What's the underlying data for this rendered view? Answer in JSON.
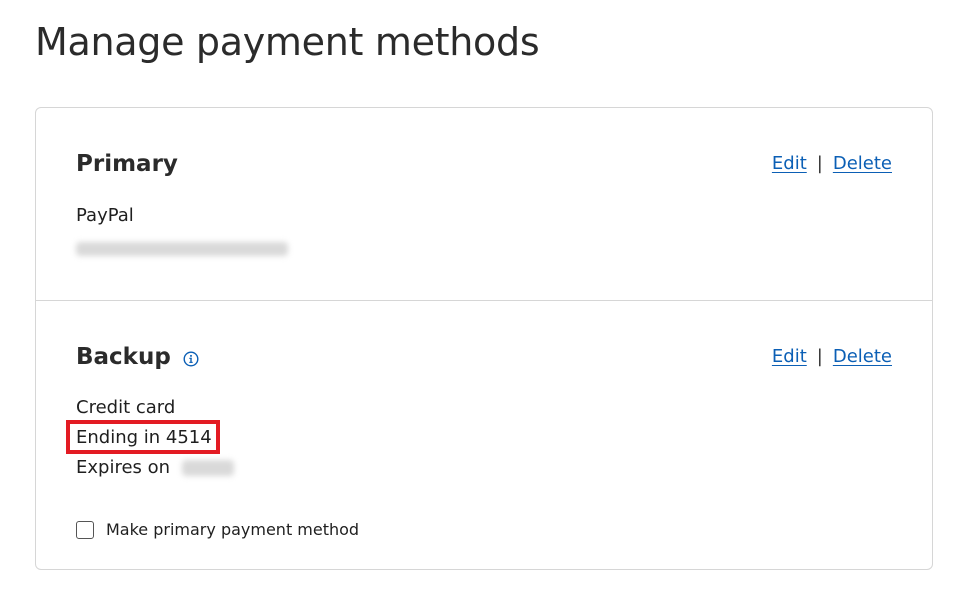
{
  "page": {
    "title": "Manage payment methods"
  },
  "primary": {
    "heading": "Primary",
    "edit_label": "Edit",
    "separator": "|",
    "delete_label": "Delete",
    "method_name": "PayPal"
  },
  "backup": {
    "heading": "Backup",
    "info_icon": "info-icon",
    "edit_label": "Edit",
    "separator": "|",
    "delete_label": "Delete",
    "method_type": "Credit card",
    "ending": "Ending in 4514",
    "expires_label": "Expires on",
    "make_primary_label": "Make primary payment method",
    "make_primary_checked": false
  },
  "colors": {
    "link": "#0b5fb5",
    "highlight": "#e31b23",
    "border": "#d6d6d6"
  }
}
